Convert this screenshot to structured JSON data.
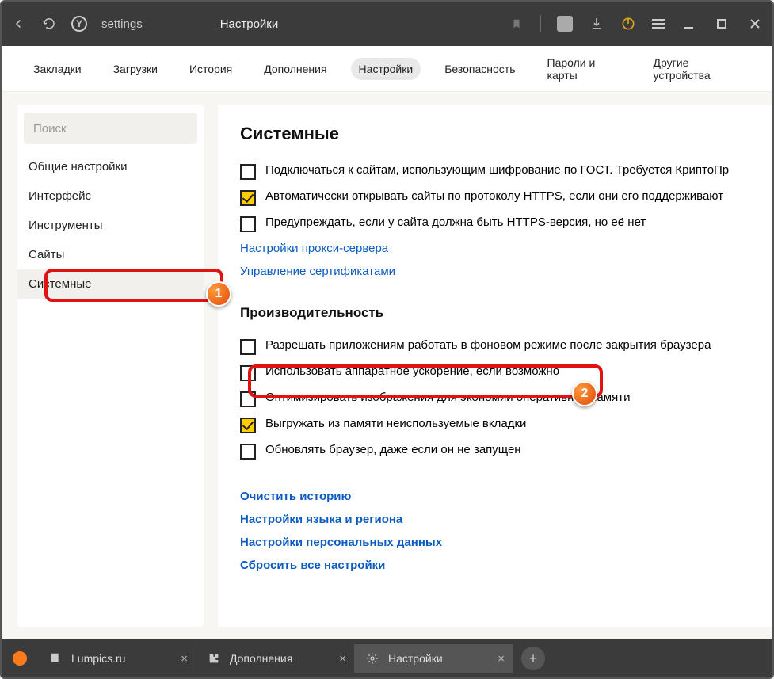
{
  "title": {
    "url": "settings",
    "page": "Настройки"
  },
  "topnav": {
    "items": [
      {
        "label": "Закладки"
      },
      {
        "label": "Загрузки"
      },
      {
        "label": "История"
      },
      {
        "label": "Дополнения"
      },
      {
        "label": "Настройки"
      },
      {
        "label": "Безопасность"
      },
      {
        "label": "Пароли и карты"
      },
      {
        "label": "Другие устройства"
      }
    ],
    "active_index": 4
  },
  "sidebar": {
    "search_placeholder": "Поиск",
    "items": [
      {
        "label": "Общие настройки"
      },
      {
        "label": "Интерфейс"
      },
      {
        "label": "Инструменты"
      },
      {
        "label": "Сайты"
      },
      {
        "label": "Системные"
      }
    ],
    "active_index": 4
  },
  "settings": {
    "system_title": "Системные",
    "system_items": [
      {
        "checked": false,
        "label": "Подключаться к сайтам, использующим шифрование по ГОСТ. Требуется КриптоПр"
      },
      {
        "checked": true,
        "label": "Автоматически открывать сайты по протоколу HTTPS, если они его поддерживают"
      },
      {
        "checked": false,
        "label": "Предупреждать, если у сайта должна быть HTTPS-версия, но её нет"
      }
    ],
    "system_links": [
      "Настройки прокси-сервера",
      "Управление сертификатами"
    ],
    "perf_title": "Производительность",
    "perf_items": [
      {
        "checked": false,
        "label": "Разрешать приложениям работать в фоновом режиме после закрытия браузера"
      },
      {
        "checked": false,
        "label": "Использовать аппаратное ускорение, если возможно"
      },
      {
        "checked": false,
        "label": "Оптимизировать изображения для экономии оперативной памяти"
      },
      {
        "checked": true,
        "label": "Выгружать из памяти неиспользуемые вкладки"
      },
      {
        "checked": false,
        "label": "Обновлять браузер, даже если он не запущен"
      }
    ],
    "bottom_links": [
      "Очистить историю",
      "Настройки языка и региона",
      "Настройки персональных данных",
      "Сбросить все настройки"
    ]
  },
  "bottom_tabs": [
    {
      "label": "Lumpics.ru",
      "icon": "page"
    },
    {
      "label": "Дополнения",
      "icon": "puzzle"
    },
    {
      "label": "Настройки",
      "icon": "gear",
      "active": true
    }
  ],
  "annotations": {
    "badge1": "1",
    "badge2": "2"
  }
}
